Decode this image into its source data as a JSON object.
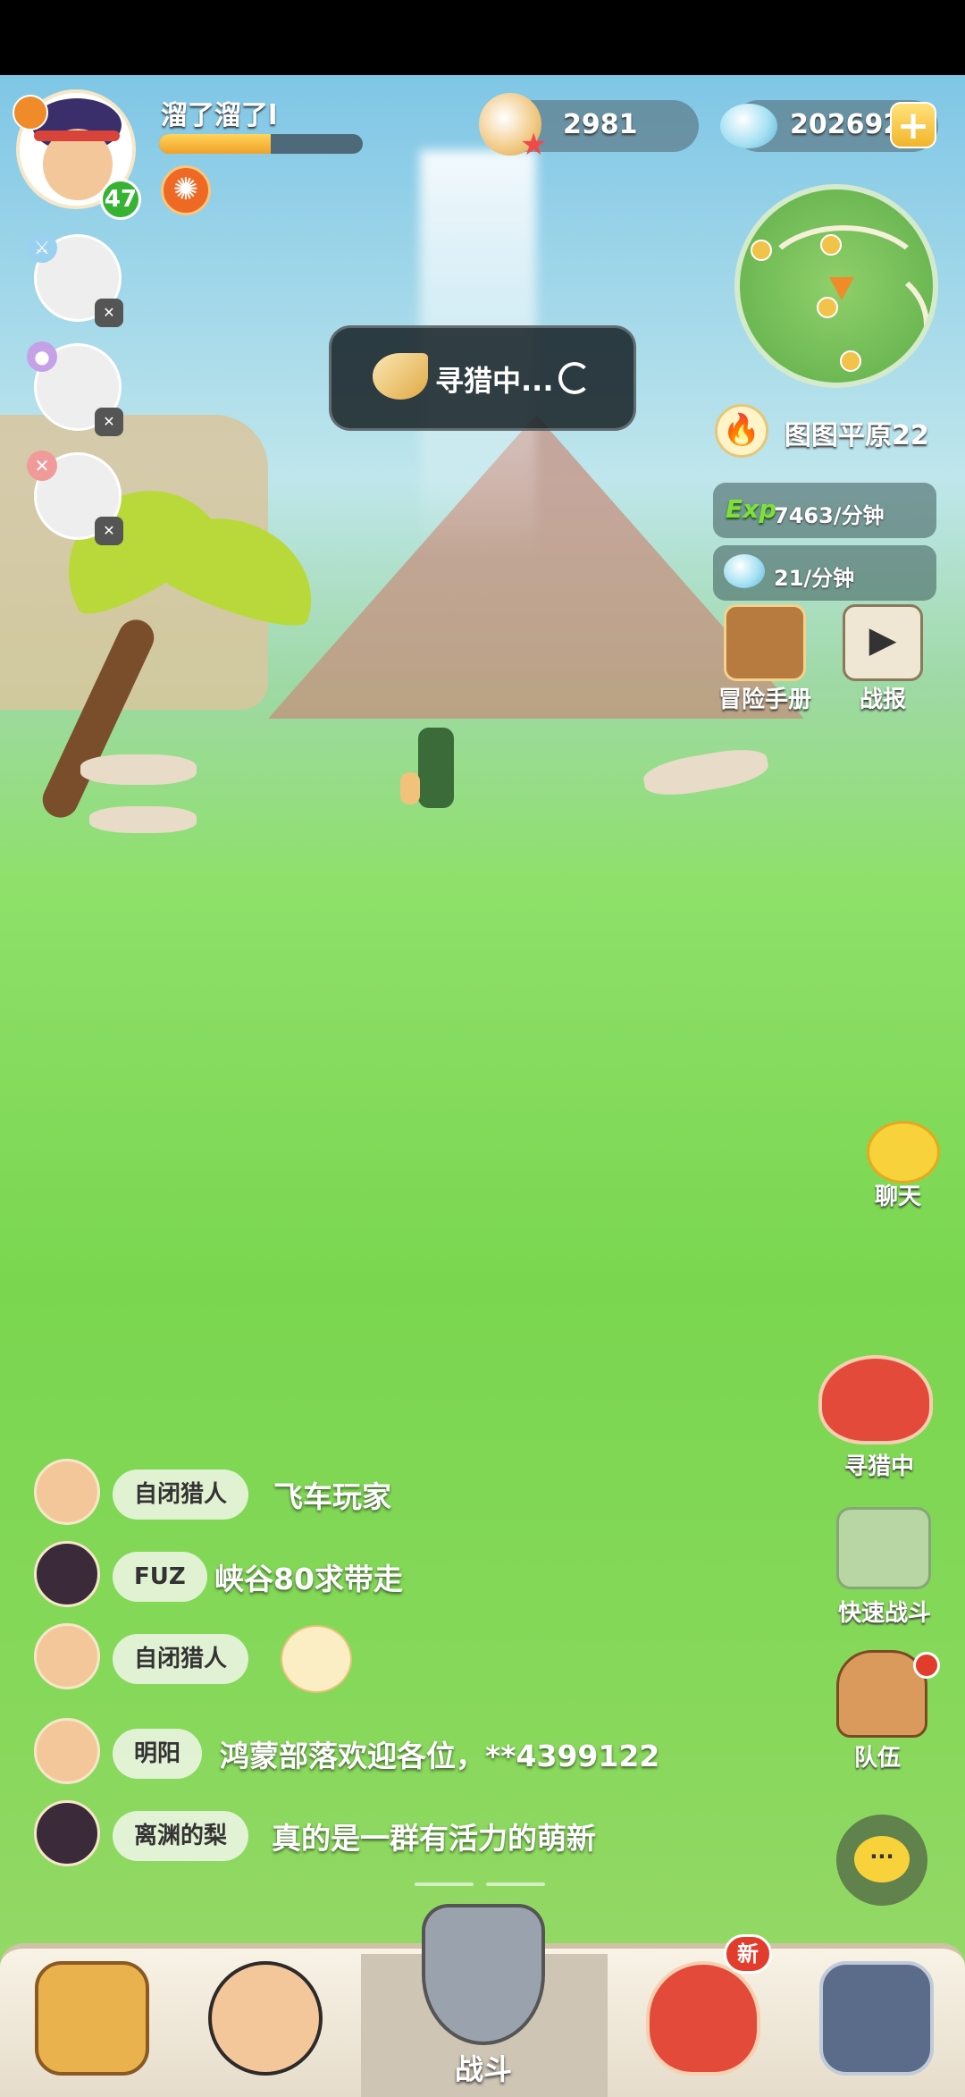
{
  "player": {
    "name": "溜了溜了l",
    "level": "47",
    "xp_fraction": 0.55
  },
  "party": [
    {
      "role_icon": "sword-icon"
    },
    {
      "role_icon": "orb-icon"
    },
    {
      "role_icon": "shield-icon"
    }
  ],
  "currency": {
    "shells": "2981",
    "gems": "202692"
  },
  "zone": {
    "name": "图图平原22"
  },
  "rates": {
    "exp_label": "Exp",
    "exp_rate": "7463/分钟",
    "gem_rate": "21/分钟"
  },
  "features": {
    "handbook": "冒险手册",
    "report": "战报"
  },
  "toast": {
    "text": "寻猎中..."
  },
  "side": {
    "chat": "聊天",
    "hunting": "寻猎中",
    "quick_battle": "快速战斗",
    "team": "队伍"
  },
  "chat": [
    {
      "name": "自闭猎人",
      "message": "飞车玩家",
      "avatar": "boy"
    },
    {
      "name": "FUZ",
      "message": "峡谷80求带走",
      "avatar": "girl"
    },
    {
      "name": "自闭猎人",
      "message": "",
      "sticker": "chick-sticker",
      "avatar": "boy"
    },
    {
      "name": "明阳",
      "message": "鸿蒙部落欢迎各位，**4399122",
      "avatar": "boy"
    },
    {
      "name": "离渊的梨",
      "message": "真的是一群有活力的萌新",
      "avatar": "girl"
    }
  ],
  "nav": {
    "battle_label": "战斗",
    "new_badge": "新"
  },
  "colors": {
    "grass": "#7ad64f",
    "accent": "#f2b52b",
    "level_badge": "#37b233",
    "new_badge": "#e23c2c"
  }
}
